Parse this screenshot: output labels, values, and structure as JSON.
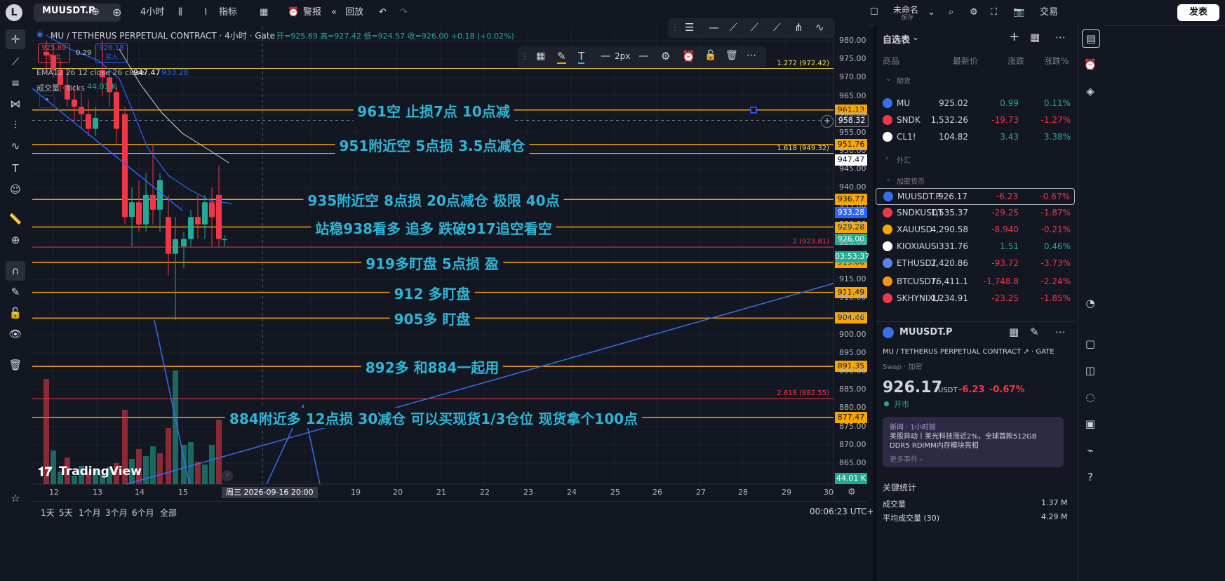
{
  "topbar": {
    "logo": "L",
    "symbol": "MUUSDT.P",
    "interval": "4小时",
    "indicators": "指标",
    "alert": "警报",
    "replay": "回放",
    "layout_name": "未命名",
    "layout_status": "保存",
    "trade": "交易",
    "publish": "发表"
  },
  "legend": {
    "title": "MU / TETHERUS PERPETUAL CONTRACT · 4小时 · Gate",
    "ohlc": "开=925.69 高=927.42 低=924.57 收=926.00 +0.18 (+0.02%)",
    "sell_price": "925.89",
    "sell_label": "卖出",
    "spread": "0.29",
    "buy_price": "926.18",
    "buy_label": "买入",
    "ema": "EMA12 26 12 close 26 close",
    "ema_v1": "947.47",
    "ema_v2": "933.28",
    "volume": "成交量 · ticks",
    "volume_v": "44.01 K"
  },
  "draw_toolbar": {
    "stroke": "2px"
  },
  "annotations": [
    {
      "text": "961空  止损7点  10点减",
      "price": 961.13
    },
    {
      "text": "951附近空     5点损   3.5点减仓",
      "price": 951.76
    },
    {
      "text": "935附近空   8点损  20点减仓  极限  40点",
      "price": 936.77
    },
    {
      "text": "站稳938看多  追多     跌破917追空看空",
      "price": 929.28
    },
    {
      "text": "919多盯盘  5点损  盈",
      "price": 919.6
    },
    {
      "text": "912  多盯盘",
      "price": 911.49
    },
    {
      "text": "905多   盯盘",
      "price": 904.46
    },
    {
      "text": "892多     和884一起用",
      "price": 891.35
    },
    {
      "text": "884附近多       12点损  30减仓      可以买现货1/3仓位   现货拿个100点",
      "price": 877.47
    }
  ],
  "fib": [
    {
      "label": "1.272 (972.42)",
      "price": 972.42
    },
    {
      "label": "1.618 (949.32)",
      "price": 949.32
    },
    {
      "label": "2 (923.81)",
      "price": 923.81
    },
    {
      "label": "2.618 (882.55)",
      "price": 882.55
    }
  ],
  "price_tags": [
    {
      "text": "961.13",
      "price": 961.13,
      "color": "#f7a600"
    },
    {
      "text": "958.32",
      "price": 958.32,
      "color": "#1e222d"
    },
    {
      "text": "951.76",
      "price": 951.76,
      "color": "#f7a600"
    },
    {
      "text": "947.47",
      "price": 947.47,
      "color": "#ffffff"
    },
    {
      "text": "936.77",
      "price": 936.77,
      "color": "#f7a600"
    },
    {
      "text": "933.28",
      "price": 933.28,
      "color": "#2962ff"
    },
    {
      "text": "929.28",
      "price": 929.28,
      "color": "#f7a600"
    },
    {
      "text": "926.00",
      "price": 926.0,
      "color": "#22ab94"
    },
    {
      "text": "919.60",
      "price": 919.6,
      "color": "#f7a600"
    },
    {
      "text": "911.49",
      "price": 911.49,
      "color": "#f7a600"
    },
    {
      "text": "904.46",
      "price": 904.46,
      "color": "#f7a600"
    },
    {
      "text": "891.35",
      "price": 891.35,
      "color": "#f7a600"
    },
    {
      "text": "877.47",
      "price": 877.47,
      "color": "#f7a600"
    }
  ],
  "countdown": "03:53:37",
  "volume_tag": "44.01 K",
  "y_ticks": [
    "980.00",
    "975.00",
    "970.00",
    "965.00",
    "960.00",
    "955.00",
    "950.00",
    "945.00",
    "940.00",
    "935.00",
    "930.00",
    "925.00",
    "920.00",
    "915.00",
    "910.00",
    "905.00",
    "900.00",
    "895.00",
    "890.00",
    "885.00",
    "880.00",
    "875.00",
    "870.00",
    "865.00"
  ],
  "x_ticks": [
    "12",
    "13",
    "14",
    "15",
    "18",
    "19",
    "20",
    "21",
    "22",
    "23",
    "24",
    "25",
    "26",
    "27",
    "28",
    "29",
    "30"
  ],
  "crosshair_date": "周三 2026-09-16   20:00",
  "tv_logo": "TradingView",
  "bottom": {
    "ranges": [
      "1天",
      "5天",
      "1个月",
      "3个月",
      "6个月",
      "全部"
    ],
    "clock": "00:06:23 UTC+8"
  },
  "watchlist": {
    "title": "自选表",
    "headers": [
      "商品",
      "最新价",
      "涨跌",
      "涨跌%"
    ],
    "group_futures": "期货",
    "group_forex": "外汇",
    "group_crypto": "加密货币",
    "rows": [
      {
        "sym": "MU",
        "price": "925.02",
        "chg": "0.99",
        "pct": "0.11%",
        "dir": "up",
        "icon": "#3a6ee8"
      },
      {
        "sym": "SNDK",
        "price": "1,532.26",
        "chg": "-19.73",
        "pct": "-1.27%",
        "dir": "down",
        "icon": "#f23645"
      },
      {
        "sym": "CL1!",
        "price": "104.82",
        "chg": "3.43",
        "pct": "3.38%",
        "dir": "up",
        "icon": "#ffffff"
      },
      {
        "sym": "MUUSDT.P",
        "price": "926.17",
        "chg": "-6.23",
        "pct": "-0.67%",
        "dir": "down",
        "icon": "#3a6ee8"
      },
      {
        "sym": "SNDKUSDT",
        "price": "1,535.37",
        "chg": "-29.25",
        "pct": "-1.87%",
        "dir": "down",
        "icon": "#f23645"
      },
      {
        "sym": "XAUUSD",
        "price": "4,290.58",
        "chg": "-8.940",
        "pct": "-0.21%",
        "dir": "down",
        "icon": "#f7a600"
      },
      {
        "sym": "KIOXIAUSI",
        "price": "331.76",
        "chg": "1.51",
        "pct": "0.46%",
        "dir": "up",
        "icon": "#ffffff"
      },
      {
        "sym": "ETHUSDT.",
        "price": "2,420.86",
        "chg": "-93.72",
        "pct": "-3.73%",
        "dir": "down",
        "icon": "#627eea"
      },
      {
        "sym": "BTCUSDT.",
        "price": "76,411.1",
        "chg": "-1,748.8",
        "pct": "-2.24%",
        "dir": "down",
        "icon": "#f7931a"
      },
      {
        "sym": "SKHYNIXU",
        "price": "1,234.91",
        "chg": "-23.25",
        "pct": "-1.85%",
        "dir": "down",
        "icon": "#f23645"
      }
    ]
  },
  "details": {
    "symbol": "MUUSDT.P",
    "desc": "MU / TETHERUS PERPETUAL CONTRACT ↗ · GATE",
    "type": "Swap · 加密",
    "price": "926.17",
    "currency": "USDT",
    "chg": "-6.23",
    "pct": "-0.67%",
    "status": "开市",
    "news_head": "新闻 · 1小时前",
    "news_body": "美股异动丨美光科技涨近2%，全球首款512GB DDR5 RDIMM内存模块亮相",
    "news_more": "更多事件 ›",
    "stats_title": "关键统计",
    "vol_label": "成交量",
    "vol_value": "1.37 M",
    "avgvol_label": "平均成交量 (30)",
    "avgvol_value": "4.29 M"
  }
}
